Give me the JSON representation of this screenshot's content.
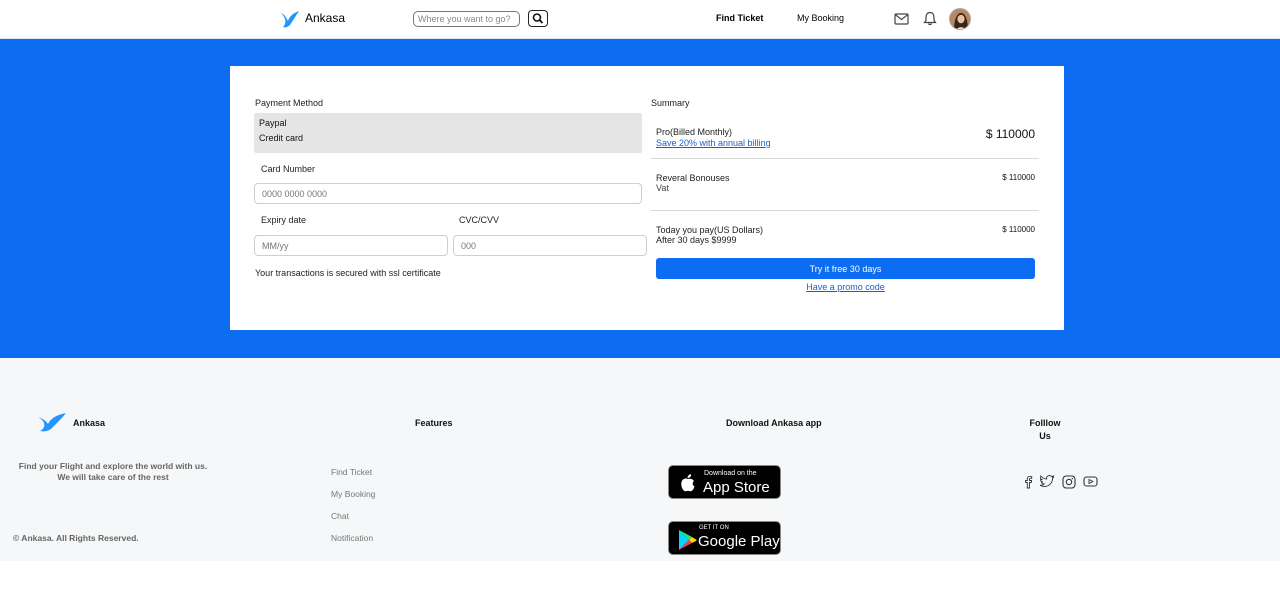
{
  "navbar": {
    "brand": "Ankasa",
    "search_placeholder": "Where you want to go?",
    "links": [
      "Find Ticket",
      "My Booking"
    ]
  },
  "payment": {
    "title": "Payment Method",
    "options": [
      "Paypal",
      "Credit card"
    ],
    "card_number_label": "Card Number",
    "card_number_placeholder": "0000 0000 0000",
    "expiry_label": "Expiry date",
    "expiry_placeholder": "MM/yy",
    "cvc_label": "CVC/CVV",
    "cvc_placeholder": "000",
    "secure_note": "Your transactions is secured with ssl certificate"
  },
  "summary": {
    "title": "Summary",
    "plan_name": "Pro(Billed Monthly)",
    "save_link": "Save 20% with annual billing",
    "plan_price": "$ 110000",
    "reveral_label": "Reveral Bonouses",
    "vat_label": "Vat",
    "reveral_price": "$ 110000",
    "today_label": "Today you pay(US Dollars)",
    "after_label": "After 30 days $9999",
    "today_price": "$ 110000",
    "try_button": "Try it free 30 days",
    "promo_link": "Have a promo code"
  },
  "footer": {
    "brand": "Ankasa",
    "tagline": "Find your Flight and explore the world with us. We will take care of the rest",
    "copyright": "© Ankasa. All Rights Reserved.",
    "features_title": "Features",
    "features": [
      "Find Ticket",
      "My Booking",
      "Chat",
      "Notification"
    ],
    "download_title": "Download Ankasa app",
    "app_store_small": "Download on the",
    "app_store_big": "App Store",
    "google_play_small": "GET IT ON",
    "google_play_big": "Google Play",
    "follow_title": "Folllow Us",
    "social_icons": [
      "facebook-icon",
      "twitter-icon",
      "instagram-icon",
      "youtube-icon"
    ]
  },
  "colors": {
    "primary": "#0c6cf2",
    "footer_bg": "#f6f7f8"
  }
}
